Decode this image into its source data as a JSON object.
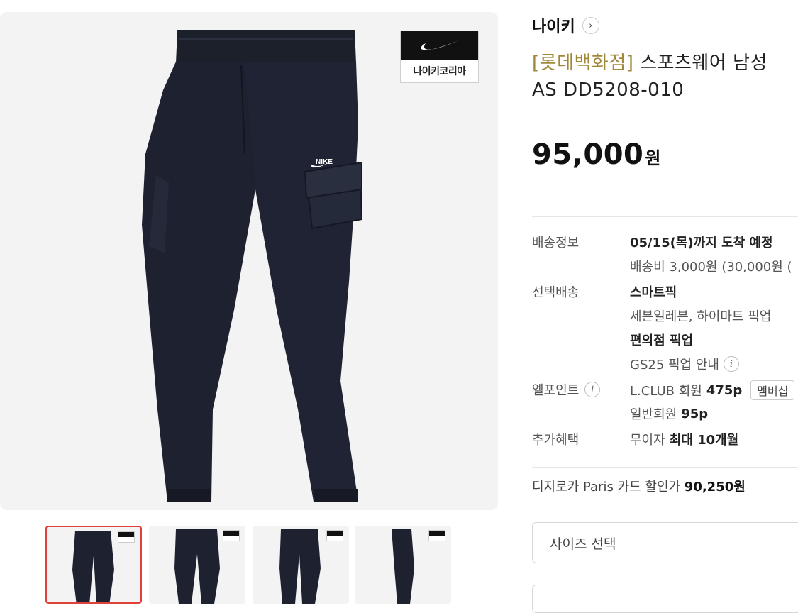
{
  "product": {
    "brand": "나이키",
    "store_tag": "[롯데백화점]",
    "title_rest": " 스포츠웨어 남성",
    "title_line2": "AS DD5208-010",
    "price": "95,000",
    "price_unit": "원",
    "badge_text": "나이키코리아"
  },
  "info": {
    "shipping_label": "배송정보",
    "shipping_date": "05/15(목)까지 도착 예정",
    "shipping_fee": "배송비 3,000원 (30,000원 (",
    "option_label": "선택배송",
    "smart_pick": "스마트픽",
    "smart_pick_desc": "세븐일레븐, 하이마트 픽업",
    "cvs_pick": "편의점 픽업",
    "gs25": "GS25 픽업 안내",
    "point_label": "엘포인트",
    "lclub": "L.CLUB 회원",
    "lclub_points": "475p",
    "member_btn": "멤버십",
    "general": "일반회원",
    "general_points": "95p",
    "benefit_label": "추가혜택",
    "benefit_prefix": "무이자",
    "benefit_value": "최대 10개월"
  },
  "card": {
    "text": "디지로카 Paris 카드 할인가",
    "price": "90,250원"
  },
  "size_select": {
    "placeholder": "사이즈 선택"
  },
  "thumbnails": [
    "thumb-1",
    "thumb-2",
    "thumb-3",
    "thumb-4"
  ]
}
